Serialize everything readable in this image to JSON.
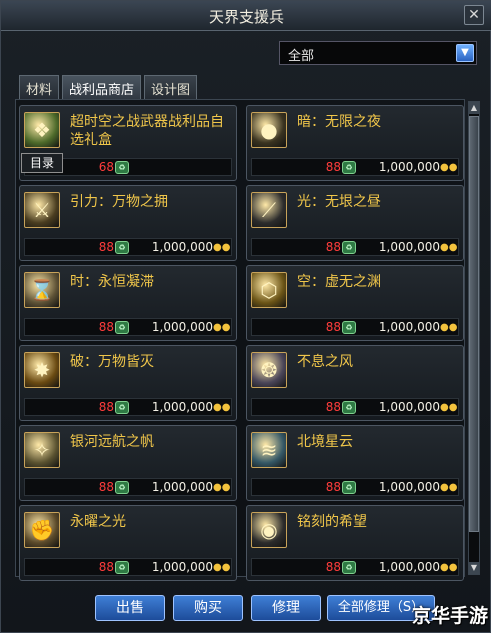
{
  "window": {
    "title": "天界支援兵",
    "close_symbol": "✕"
  },
  "filter": {
    "selected": "全部"
  },
  "tabs": [
    {
      "label": "材料",
      "active": false
    },
    {
      "label": "战利品商店",
      "active": true
    },
    {
      "label": "设计图",
      "active": false
    }
  ],
  "catalog_badge": "目录",
  "items": [
    {
      "name": "超时空之战武器战利品自选礼盒",
      "qty": "68",
      "price": "",
      "icon": "gift-box-icon",
      "icon_color": "#4d6a2a"
    },
    {
      "name": "暗：无限之夜",
      "qty": "88",
      "price": "1,000,000",
      "icon": "dark-orb-icon",
      "icon_color": "#3a3320"
    },
    {
      "name": "引力：万物之拥",
      "qty": "88",
      "price": "1,000,000",
      "icon": "sword-icon",
      "icon_color": "#4a3d20"
    },
    {
      "name": "光：无垠之昼",
      "qty": "88",
      "price": "1,000,000",
      "icon": "light-blade-icon",
      "icon_color": "#2c2c2c"
    },
    {
      "name": "时：永恒凝滞",
      "qty": "88",
      "price": "1,000,000",
      "icon": "clock-staff-icon",
      "icon_color": "#5e5236"
    },
    {
      "name": "空：虚无之渊",
      "qty": "88",
      "price": "1,000,000",
      "icon": "gold-ring-icon",
      "icon_color": "#6b5416"
    },
    {
      "name": "破：万物皆灭",
      "qty": "88",
      "price": "1,000,000",
      "icon": "burst-icon",
      "icon_color": "#6a4a12"
    },
    {
      "name": "不息之风",
      "qty": "88",
      "price": "1,000,000",
      "icon": "wind-gem-icon",
      "icon_color": "#4a4558"
    },
    {
      "name": "银河远航之帆",
      "qty": "88",
      "price": "1,000,000",
      "icon": "compass-icon",
      "icon_color": "#5a5230"
    },
    {
      "name": "北境星云",
      "qty": "88",
      "price": "1,000,000",
      "icon": "nebula-icon",
      "icon_color": "#355866"
    },
    {
      "name": "永曜之光",
      "qty": "88",
      "price": "1,000,000",
      "icon": "gauntlet-icon",
      "icon_color": "#5b4a2a"
    },
    {
      "name": "铭刻的希望",
      "qty": "88",
      "price": "1,000,000",
      "icon": "dark-sphere-icon",
      "icon_color": "#2b2b2b"
    }
  ],
  "buttons": {
    "sell": "出售",
    "buy": "购买",
    "repair": "修理",
    "repair_all": "全部修理（S）"
  },
  "watermark": "京华手游",
  "icons": {
    "qty": "coin-stack-icon",
    "gold": "gold-coins-icon"
  },
  "colors": {
    "name_text": "#f0c64a",
    "qty_text": "#ff3c3c",
    "button": "#2f6cc4"
  }
}
